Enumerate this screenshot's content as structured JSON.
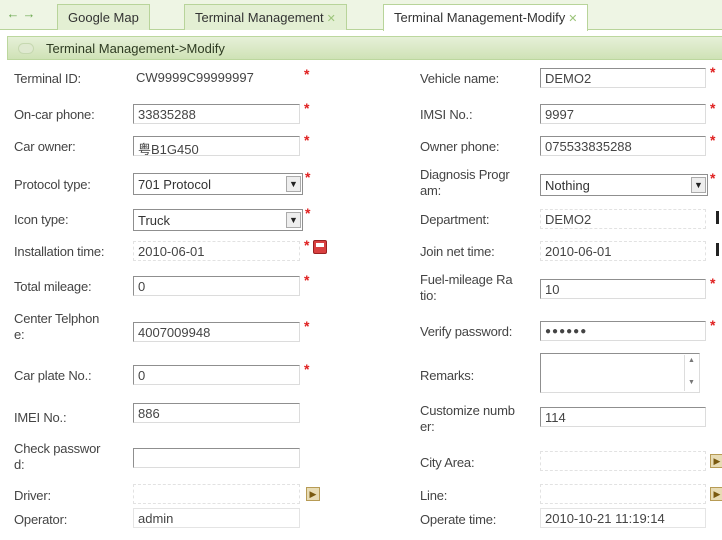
{
  "tabs": {
    "nav_back": "←",
    "nav_forward": "→",
    "items": [
      {
        "label": "Google Map",
        "closable": false
      },
      {
        "label": "Terminal Management",
        "closable": true
      },
      {
        "label": "Terminal Management-Modify",
        "closable": true
      }
    ],
    "close_glyph": "✕"
  },
  "panel": {
    "title": "Terminal Management->Modify"
  },
  "form": {
    "terminal_id": {
      "label": "Terminal ID:",
      "value": "CW9999C99999997"
    },
    "on_car_phone": {
      "label": "On-car phone:",
      "value": "33835288"
    },
    "car_owner": {
      "label": "Car owner:",
      "value": "粤B1G450"
    },
    "protocol_type": {
      "label": "Protocol type:",
      "value": "701 Protocol"
    },
    "icon_type": {
      "label": "Icon type:",
      "value": "Truck"
    },
    "installation_time": {
      "label": "Installation time:",
      "value": "2010-06-01"
    },
    "total_mileage": {
      "label": "Total mileage:",
      "value": "0"
    },
    "center_telphone": {
      "label_1": "Center Telphon",
      "label_2": "e:",
      "value": "4007009948"
    },
    "car_plate_no": {
      "label": "Car plate No.:",
      "value": "0"
    },
    "imei_no": {
      "label": "IMEI No.:",
      "value": "886"
    },
    "check_password": {
      "label_1": "Check passwor",
      "label_2": "d:",
      "value": ""
    },
    "driver": {
      "label": "Driver:",
      "value": ""
    },
    "operator": {
      "label": "Operator:",
      "value": "admin"
    },
    "vehicle_name": {
      "label": "Vehicle name:",
      "value": "DEMO2"
    },
    "imsi_no": {
      "label": "IMSI No.:",
      "value": "9997"
    },
    "owner_phone": {
      "label": "Owner phone:",
      "value": "075533835288"
    },
    "diagnosis_program": {
      "label_1": "Diagnosis Progr",
      "label_2": "am:",
      "value": "Nothing"
    },
    "department": {
      "label": "Department:",
      "value": "DEMO2"
    },
    "join_net_time": {
      "label": "Join net time:",
      "value": "2010-06-01"
    },
    "fuel_mileage_ratio": {
      "label_1": "Fuel-mileage Ra",
      "label_2": "tio:",
      "value": "10"
    },
    "verify_password": {
      "label": "Verify password:",
      "value": "●●●●●●"
    },
    "remarks": {
      "label": "Remarks:",
      "value": ""
    },
    "customize_number": {
      "label_1": "Customize numb",
      "label_2": "er:",
      "value": "114"
    },
    "city_area": {
      "label": "City Area:",
      "value": ""
    },
    "line": {
      "label": "Line:",
      "value": ""
    },
    "operate_time": {
      "label": "Operate time:",
      "value": "2010-10-21 11:19:14"
    }
  },
  "glyphs": {
    "required": "*",
    "select_arrow": "▼",
    "pick": "▶",
    "scroll_up": "▲",
    "scroll_down": "▼"
  },
  "colors": {
    "tab_bar_bg": "#eef5e4",
    "panel_header": "#cfe2b6",
    "required_mark": "#e02020"
  }
}
